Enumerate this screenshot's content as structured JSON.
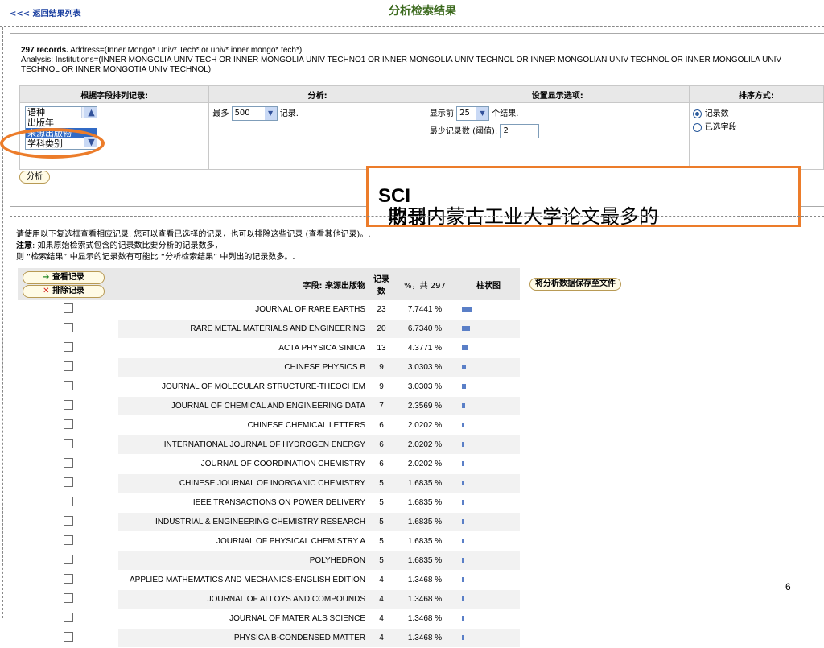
{
  "header": {
    "back_link": "<<< 返回结果列表",
    "title": "分析检索结果"
  },
  "summary": {
    "records_bold": "297 records.",
    "address": "Address=(Inner Mongo* Univ* Tech* or univ* inner mongo* tech*)",
    "analysis": "Analysis: Institutions=(INNER MONGOLIA UNIV TECH OR INNER MONGOLIA UNIV TECHNO1 OR INNER MONGOLIA UNIV TECHNOL OR INNER MONGOLIAN UNIV TECHNOL OR INNER MONGOLILA UNIV TECHNOL OR INNER MONGOTIA UNIV TECHNOL)"
  },
  "options": {
    "col1_header": "根据字段排列记录:",
    "col2_header": "分析:",
    "col3_header": "设置显示选项:",
    "col4_header": "排序方式:",
    "field_list": [
      "语种",
      "出版年",
      "来源出版物",
      "学科类别"
    ],
    "field_selected": "来源出版物",
    "max_prefix": "最多",
    "max_value": "500",
    "max_suffix": "记录.",
    "show_prefix": "显示前",
    "show_value": "25",
    "show_suffix": "个结果.",
    "min_label": "最少记录数 (阈值):",
    "min_value": "2",
    "sort_records": "记录数",
    "sort_field": "已选字段",
    "analyze_button": "分析"
  },
  "callout": {
    "text_pre": "收录内蒙古工业大学论文最多的",
    "text_bold": "SCI",
    "text_post": "期刊"
  },
  "notes": {
    "line1": "请使用以下复选框查看相应记录. 您可以查看已选择的记录，也可以排除这些记录 (查看其他记录)。.",
    "line2_bold": "注意",
    "line2": ": 如果原始检索式包含的记录数比要分析的记录数多，",
    "line3": "则 “检索结果” 中显示的记录数有可能比 “分析检索结果” 中列出的记录数多。."
  },
  "results": {
    "view_button": "查看记录",
    "exclude_button": "排除记录",
    "field_header": "字段: 来源出版物",
    "count_header": "记录数",
    "pct_header": "%，共 297",
    "bar_header": "柱状图",
    "save_button": "将分析数据保存至文件",
    "rows": [
      {
        "name": "JOURNAL OF RARE EARTHS",
        "count": "23",
        "pct": "7.7441 %",
        "frac": 0.077441
      },
      {
        "name": "RARE METAL MATERIALS AND ENGINEERING",
        "count": "20",
        "pct": "6.7340 %",
        "frac": 0.06734
      },
      {
        "name": "ACTA PHYSICA SINICA",
        "count": "13",
        "pct": "4.3771 %",
        "frac": 0.043771
      },
      {
        "name": "CHINESE PHYSICS B",
        "count": "9",
        "pct": "3.0303 %",
        "frac": 0.030303
      },
      {
        "name": "JOURNAL OF MOLECULAR STRUCTURE-THEOCHEM",
        "count": "9",
        "pct": "3.0303 %",
        "frac": 0.030303
      },
      {
        "name": "JOURNAL OF CHEMICAL AND ENGINEERING DATA",
        "count": "7",
        "pct": "2.3569 %",
        "frac": 0.023569
      },
      {
        "name": "CHINESE CHEMICAL LETTERS",
        "count": "6",
        "pct": "2.0202 %",
        "frac": 0.020202
      },
      {
        "name": "INTERNATIONAL JOURNAL OF HYDROGEN ENERGY",
        "count": "6",
        "pct": "2.0202 %",
        "frac": 0.020202
      },
      {
        "name": "JOURNAL OF COORDINATION CHEMISTRY",
        "count": "6",
        "pct": "2.0202 %",
        "frac": 0.020202
      },
      {
        "name": "CHINESE JOURNAL OF INORGANIC CHEMISTRY",
        "count": "5",
        "pct": "1.6835 %",
        "frac": 0.016835
      },
      {
        "name": "IEEE TRANSACTIONS ON POWER DELIVERY",
        "count": "5",
        "pct": "1.6835 %",
        "frac": 0.016835
      },
      {
        "name": "INDUSTRIAL & ENGINEERING CHEMISTRY RESEARCH",
        "count": "5",
        "pct": "1.6835 %",
        "frac": 0.016835
      },
      {
        "name": "JOURNAL OF PHYSICAL CHEMISTRY A",
        "count": "5",
        "pct": "1.6835 %",
        "frac": 0.016835
      },
      {
        "name": "POLYHEDRON",
        "count": "5",
        "pct": "1.6835 %",
        "frac": 0.016835
      },
      {
        "name": "APPLIED MATHEMATICS AND MECHANICS-ENGLISH EDITION",
        "count": "4",
        "pct": "1.3468 %",
        "frac": 0.013468
      },
      {
        "name": "JOURNAL OF ALLOYS AND COMPOUNDS",
        "count": "4",
        "pct": "1.3468 %",
        "frac": 0.013468
      },
      {
        "name": "JOURNAL OF MATERIALS SCIENCE",
        "count": "4",
        "pct": "1.3468 %",
        "frac": 0.013468
      },
      {
        "name": "PHYSICA B-CONDENSED MATTER",
        "count": "4",
        "pct": "1.3468 %",
        "frac": 0.013468
      }
    ]
  },
  "page_number": "6",
  "colors": {
    "accent": "#ec7c2a",
    "bar": "#5a7fc7",
    "title": "#3c6a1e",
    "link": "#1a3fa0"
  }
}
